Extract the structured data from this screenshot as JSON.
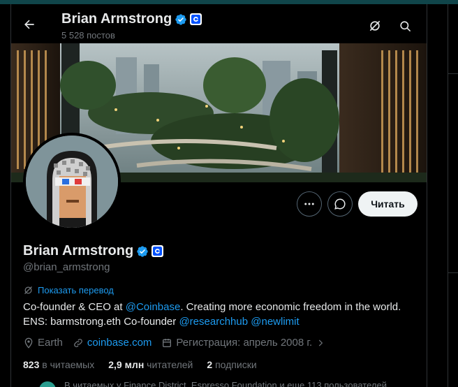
{
  "header": {
    "name": "Brian Armstrong",
    "post_count": "5 528 постов",
    "back_icon": "arrow-left-icon",
    "grok_icon": "grok-slash-icon",
    "search_icon": "search-icon"
  },
  "profile": {
    "name": "Brian Armstrong",
    "handle": "@brian_armstrong",
    "translate_label": "Показать перевод",
    "bio": {
      "line1_prefix": "Co-founder & CEO at ",
      "line1_link": "@Coinbase",
      "line1_suffix": ". Creating more economic freedom in the world.",
      "line2_prefix": "ENS: barmstrong.eth Co-founder ",
      "line2_link1": "@researchhub",
      "line2_link2": "@newlimit"
    },
    "location": "Earth",
    "website": "coinbase.com",
    "joined": "Регистрация: апрель 2008 г.",
    "following_count": "823",
    "following_label": "в читаемых",
    "followers_count": "2,9 млн",
    "followers_label": "читателей",
    "subscriptions_count": "2",
    "subscriptions_label": "подписки",
    "followed_by": "В читаемых у Finance District, Espresso Foundation и еще 113 пользователей"
  },
  "actions": {
    "more_icon": "more-icon",
    "message_icon": "message-icon",
    "follow_label": "Читать"
  },
  "colors": {
    "accent": "#1d9bf0",
    "verified": "#1d9bf0",
    "coinbase": "#0052ff",
    "background": "#000000"
  }
}
